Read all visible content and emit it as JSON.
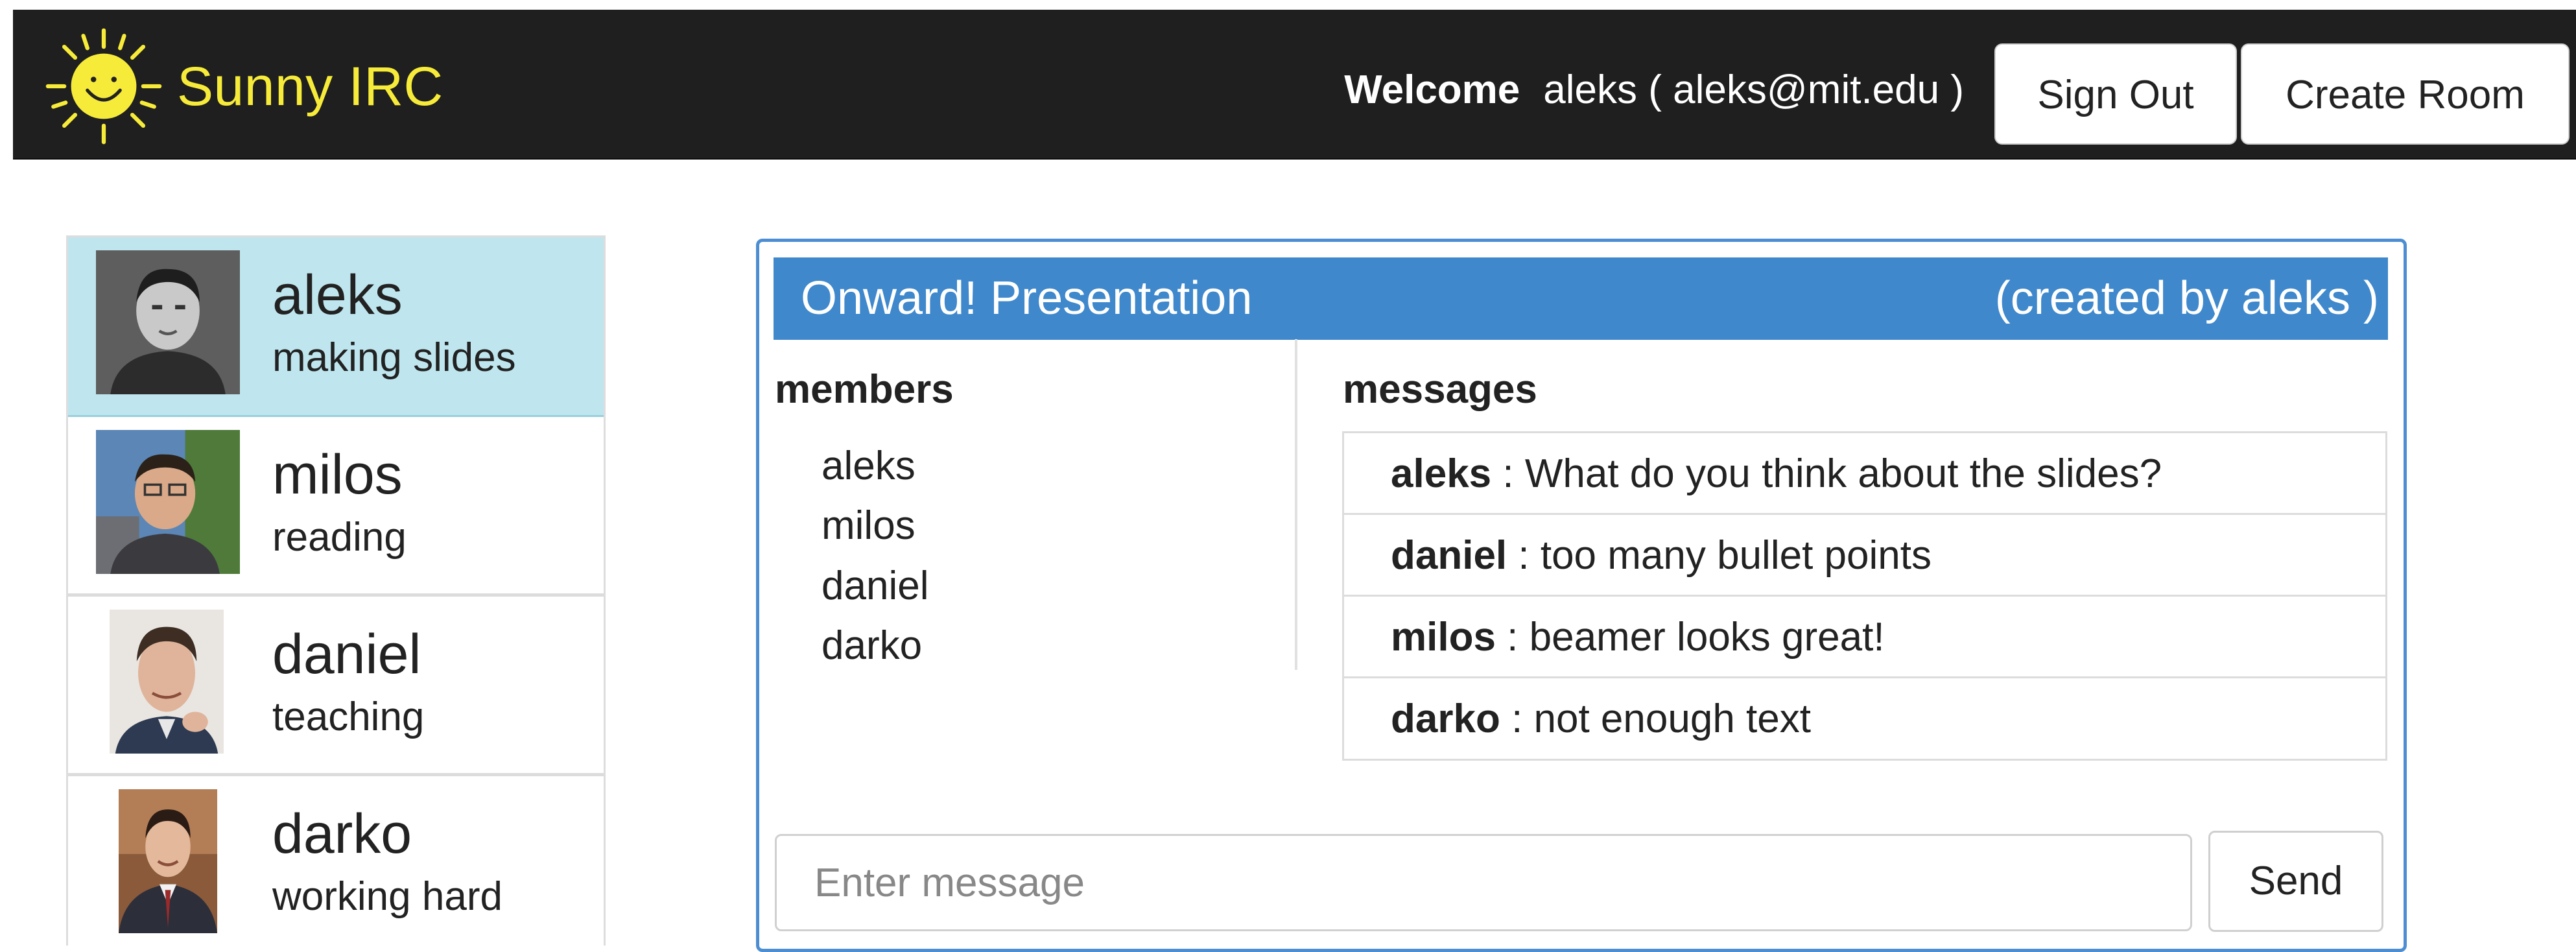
{
  "app": {
    "name": "Sunny IRC",
    "logo_icon": "smiling-sun-icon",
    "brand_color": "#f7eb3a"
  },
  "header": {
    "welcome_label": "Welcome",
    "user_display": "aleks ( aleks@mit.edu )",
    "sign_out_label": "Sign Out",
    "create_room_label": "Create Room"
  },
  "users": [
    {
      "name": "aleks",
      "status": "making slides",
      "active": true
    },
    {
      "name": "milos",
      "status": "reading",
      "active": false
    },
    {
      "name": "daniel",
      "status": "teaching",
      "active": false
    },
    {
      "name": "darko",
      "status": "working hard",
      "active": false
    }
  ],
  "room": {
    "title": "Onward! Presentation",
    "creator_text": "(created by aleks )",
    "members_label": "members",
    "messages_label": "messages",
    "members": [
      "aleks",
      "milos",
      "daniel",
      "darko"
    ],
    "messages": [
      {
        "author": "aleks",
        "text": " : What do you think about the slides?"
      },
      {
        "author": "daniel",
        "text": " : too many bullet points"
      },
      {
        "author": "milos",
        "text": " : beamer looks great!"
      },
      {
        "author": "darko",
        "text": " : not enough text"
      }
    ],
    "input_placeholder": "Enter message",
    "send_label": "Send"
  },
  "colors": {
    "navbar_bg": "#1f1f1f",
    "active_user_bg": "#bfe6ee",
    "room_header_bg": "#3f88cc"
  }
}
